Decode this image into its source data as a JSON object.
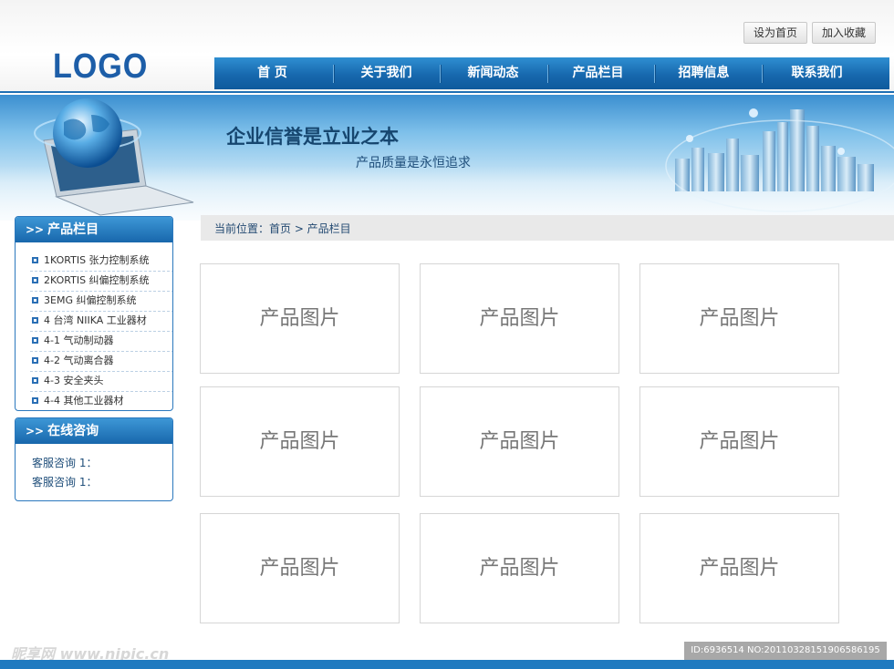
{
  "header": {
    "logo": "LOGO",
    "btn_home": "设为首页",
    "btn_fav": "加入收藏"
  },
  "nav": [
    "首 页",
    "关于我们",
    "新闻动态",
    "产品栏目",
    "招聘信息",
    "联系我们"
  ],
  "banner": {
    "title": "企业信誉是立业之本",
    "subtitle": "产品质量是永恒追求"
  },
  "breadcrumb": "当前位置：首页 > 产品栏目",
  "sidebar": {
    "products_title": "产品栏目",
    "products": [
      "1KORTIS 张力控制系统",
      "2KORTIS 纠偏控制系统",
      "3EMG 纠偏控制系统",
      "4 台湾 NIIKA 工业器材",
      "4-1 气动制动器",
      "4-2 气动离合器",
      "4-3 安全夹头",
      "4-4 其他工业器材"
    ],
    "consult_title": "在线咨询",
    "consult_items": [
      "客服咨询 1：",
      "客服咨询 1："
    ]
  },
  "products_grid": [
    "产品图片",
    "产品图片",
    "产品图片",
    "产品图片",
    "产品图片",
    "产品图片",
    "产品图片",
    "产品图片",
    "产品图片"
  ],
  "watermark": {
    "left": "昵享网 www.nipic.cn",
    "right": "ID:6936514 NO:20110328151906586195"
  },
  "colors": {
    "primary": "#1867ac",
    "nav_top": "#2f8fd2",
    "footer": "#1f7ac0"
  }
}
